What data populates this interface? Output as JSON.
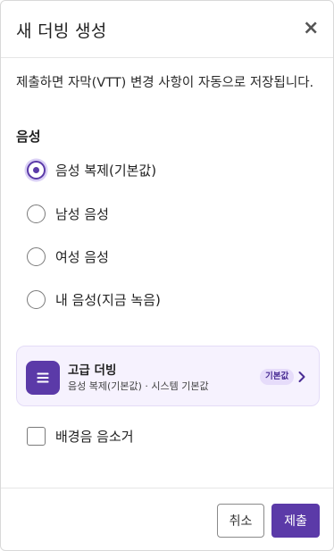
{
  "dialog": {
    "title": "새 더빙 생성",
    "close_label": "×",
    "notice": "제출하면 자막(VTT) 변경 사항이 자동으로 저장됩니다."
  },
  "voice": {
    "section_label": "음성",
    "options": [
      {
        "label": "음성 복제(기본값)",
        "checked": true
      },
      {
        "label": "남성 음성",
        "checked": false
      },
      {
        "label": "여성 음성",
        "checked": false
      },
      {
        "label": "내 음성(지금 녹음)",
        "checked": false
      }
    ]
  },
  "advanced": {
    "title": "고급 더빙",
    "subtitle": "음성 복제(기본값) · 시스템 기본값",
    "badge": "기본값",
    "icon": "menu-lines-icon",
    "chevron_icon": "chevron-right-icon"
  },
  "background_removal": {
    "label": "배경음 음소거",
    "checked": false
  },
  "footer": {
    "cancel_label": "취소",
    "submit_label": "제출"
  },
  "colors": {
    "accent": "#5b3aa8",
    "accent_light": "#f6f2fe",
    "badge_bg": "#e6dcfa"
  }
}
